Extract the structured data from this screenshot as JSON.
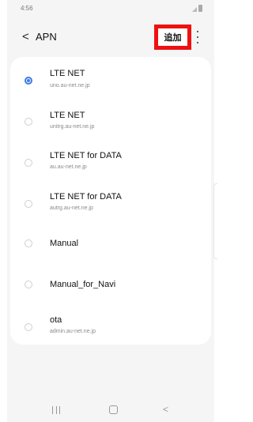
{
  "status_bar": {
    "time": "4:56"
  },
  "app_bar": {
    "back_icon": "<",
    "title": "APN",
    "add_label": "追加",
    "more_icon": "more-vertical-icon"
  },
  "apn_list": [
    {
      "name": "LTE NET",
      "apn": "uno.au-net.ne.jp",
      "selected": true
    },
    {
      "name": "LTE NET",
      "apn": "unitrg.au-net.ne.jp",
      "selected": false
    },
    {
      "name": "LTE NET for DATA",
      "apn": "au.au-net.ne.jp",
      "selected": false
    },
    {
      "name": "LTE NET for DATA",
      "apn": "autrg.au-net.ne.jp",
      "selected": false
    },
    {
      "name": "Manual",
      "apn": "",
      "selected": false
    },
    {
      "name": "Manual_for_Navi",
      "apn": "",
      "selected": false
    },
    {
      "name": "ota",
      "apn": "admin.au-net.ne.jp",
      "selected": false
    }
  ],
  "nav_bar": {
    "back_icon": "<"
  },
  "colors": {
    "accent": "#3e7be6",
    "highlight_box": "#ee1111",
    "background": "#f5f5f5"
  }
}
